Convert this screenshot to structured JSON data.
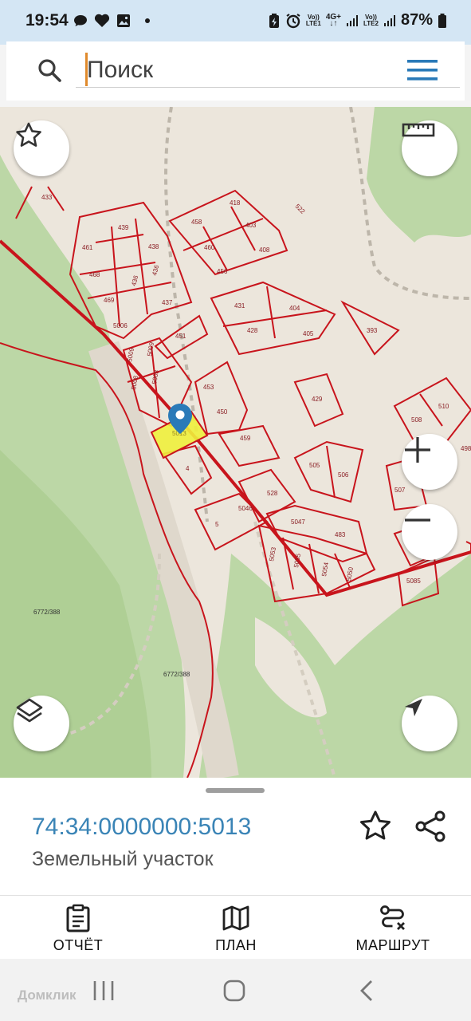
{
  "status_bar": {
    "time": "19:54",
    "network1": "Vo))\nLTE1",
    "network_type": "4G+",
    "network2": "Vo))\nLTE2",
    "battery": "87%"
  },
  "search": {
    "placeholder": "Поиск"
  },
  "map": {
    "parcel_labels": [
      "433",
      "439",
      "461",
      "438",
      "468",
      "436",
      "436",
      "469",
      "437",
      "5006",
      "458",
      "418",
      "403",
      "460",
      "408",
      "456",
      "431",
      "404",
      "428",
      "405",
      "393",
      "451",
      "5009",
      "5009",
      "5008",
      "5008",
      "453",
      "5013",
      "450",
      "459",
      "4",
      "429",
      "508",
      "510",
      "498",
      "505",
      "506",
      "507",
      "528",
      "5046",
      "5",
      "5047",
      "483",
      "5053",
      "5055",
      "5054",
      "5050",
      "5085",
      "522",
      "6772/388",
      "6772/388"
    ],
    "selected_parcel": "5013"
  },
  "info_card": {
    "cadastral_number": "74:34:0000000:5013",
    "object_type": "Земельный участок"
  },
  "tabs": [
    {
      "label": "ОТЧЁТ",
      "icon": "clipboard-icon"
    },
    {
      "label": "ПЛАН",
      "icon": "map-icon"
    },
    {
      "label": "МАРШРУТ",
      "icon": "route-icon"
    }
  ],
  "watermark": "Домклик",
  "colors": {
    "accent": "#3a84b6",
    "parcel_border": "#c8141c",
    "selected_fill": "#f0f03c",
    "status_bar": "#d4e6f4"
  }
}
